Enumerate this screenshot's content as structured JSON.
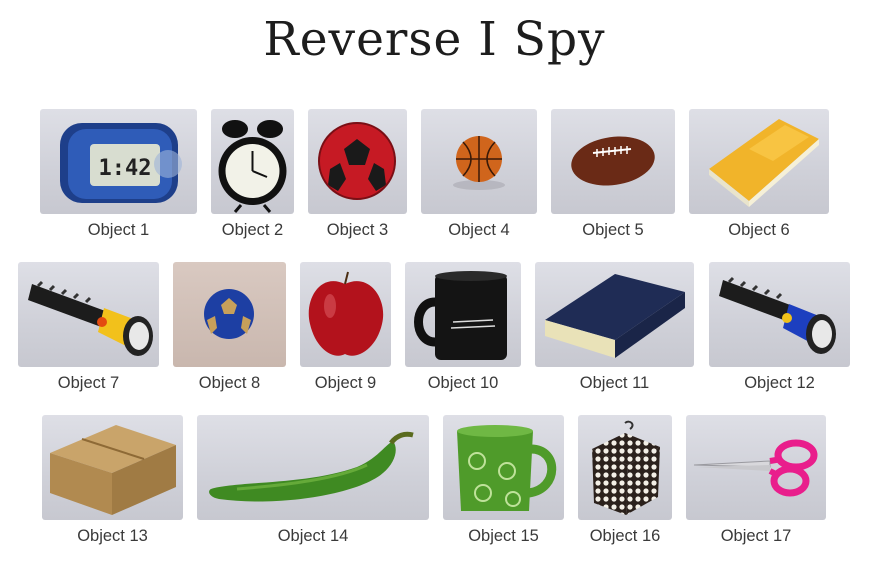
{
  "page": {
    "title": "Reverse I Spy"
  },
  "objects": [
    {
      "label": "Object 1",
      "icon": "alarm-clock-radio",
      "display": "1:42"
    },
    {
      "label": "Object 2",
      "icon": "twin-bell-alarm-clock"
    },
    {
      "label": "Object 3",
      "icon": "red-black-soccer-ball"
    },
    {
      "label": "Object 4",
      "icon": "mini-basketball"
    },
    {
      "label": "Object 5",
      "icon": "american-football"
    },
    {
      "label": "Object 6",
      "icon": "yellow-textbook"
    },
    {
      "label": "Object 7",
      "icon": "yellow-flashlight"
    },
    {
      "label": "Object 8",
      "icon": "blue-gold-ball"
    },
    {
      "label": "Object 9",
      "icon": "red-apple"
    },
    {
      "label": "Object 10",
      "icon": "black-mug"
    },
    {
      "label": "Object 11",
      "icon": "navy-book"
    },
    {
      "label": "Object 12",
      "icon": "blue-flashlight"
    },
    {
      "label": "Object 13",
      "icon": "cardboard-box"
    },
    {
      "label": "Object 14",
      "icon": "green-chili-pepper"
    },
    {
      "label": "Object 15",
      "icon": "green-peace-mug"
    },
    {
      "label": "Object 16",
      "icon": "patterned-box"
    },
    {
      "label": "Object 17",
      "icon": "pink-scissors"
    }
  ]
}
